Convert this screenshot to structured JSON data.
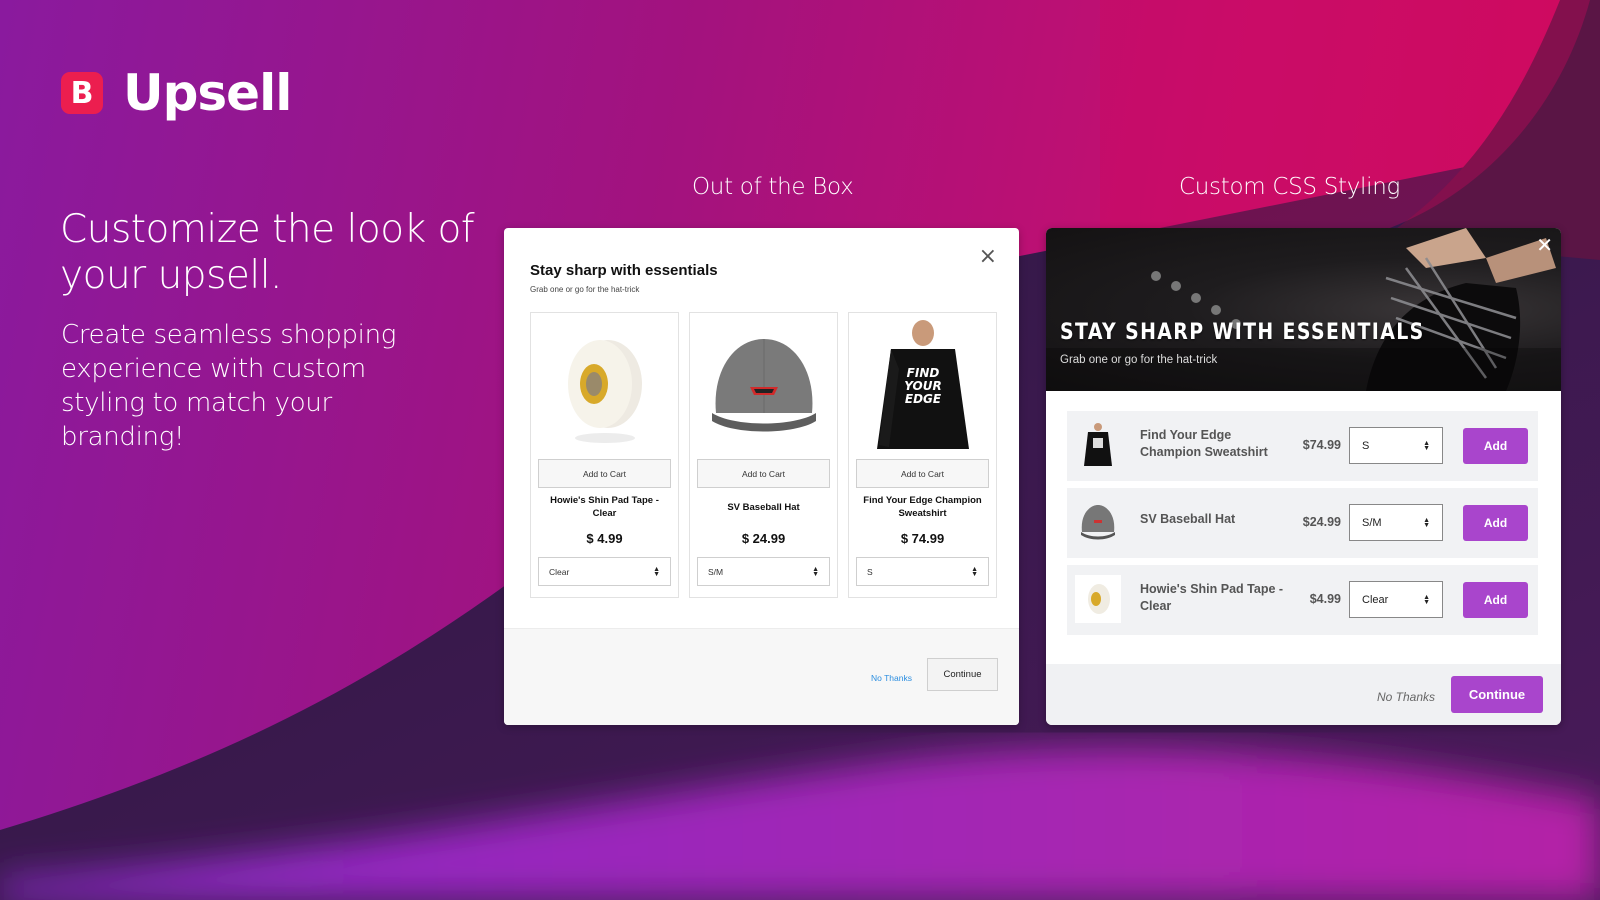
{
  "brand": {
    "logo_letter": "B",
    "name": "Upsell",
    "accent": "#ec1e4f"
  },
  "hero_copy": {
    "headline": "Customize the look of your upsell.",
    "subcopy": "Create seamless shopping experience with custom styling to match your branding!"
  },
  "labels": {
    "out_of_box": "Out of the Box",
    "custom_css": "Custom CSS Styling"
  },
  "modal_default": {
    "title": "Stay sharp with essentials",
    "subtitle": "Grab one or go for the hat-trick",
    "close_icon": "×",
    "products": [
      {
        "name": "Howie's Shin Pad Tape - Clear",
        "price": "$ 4.99",
        "button": "Add to Cart",
        "option": "Clear",
        "image": "tape-roll"
      },
      {
        "name": "SV Baseball Hat",
        "price": "$ 24.99",
        "button": "Add to Cart",
        "option": "S/M",
        "image": "baseball-hat"
      },
      {
        "name": "Find Your Edge Champion Sweatshirt",
        "price": "$ 74.99",
        "button": "Add to Cart",
        "option": "S",
        "image": "sweatshirt"
      }
    ],
    "no_thanks": "No Thanks",
    "continue": "Continue",
    "link_color": "#2c8ee0"
  },
  "modal_custom": {
    "title": "STAY SHARP WITH ESSENTIALS",
    "subtitle": "Grab one or go for the hat-trick",
    "close_icon": "✕",
    "products": [
      {
        "name": "Find Your Edge Champion Sweatshirt",
        "price": "$74.99",
        "option": "S",
        "button": "Add",
        "image": "sweatshirt"
      },
      {
        "name": "SV Baseball Hat",
        "price": "$24.99",
        "option": "S/M",
        "button": "Add",
        "image": "baseball-hat"
      },
      {
        "name": "Howie's Shin Pad Tape - Clear",
        "price": "$4.99",
        "option": "Clear",
        "button": "Add",
        "image": "tape-roll"
      }
    ],
    "no_thanks": "No Thanks",
    "continue": "Continue",
    "button_color": "#a945cc"
  },
  "sweatshirt_print": [
    "FIND",
    "YOUR",
    "EDGE"
  ]
}
